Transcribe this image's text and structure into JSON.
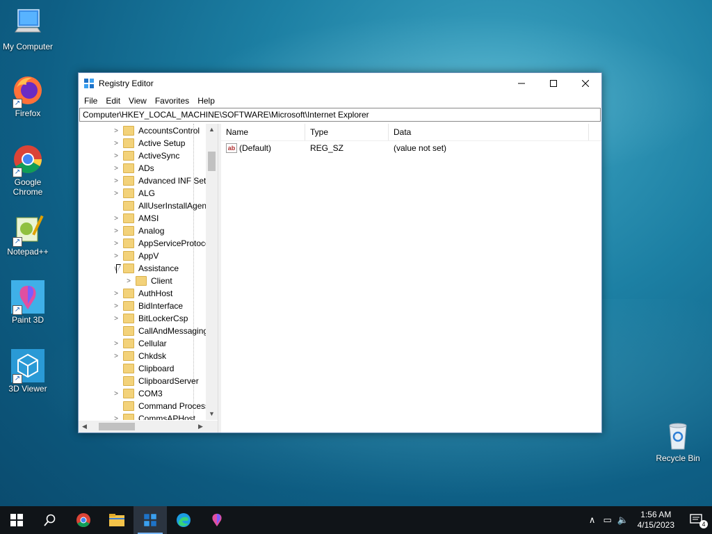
{
  "desktop": {
    "icons": [
      {
        "label": "My Computer"
      },
      {
        "label": "Firefox"
      },
      {
        "label": "Google Chrome"
      },
      {
        "label": "Notepad++"
      },
      {
        "label": "Paint 3D"
      },
      {
        "label": "3D Viewer"
      },
      {
        "label": "Recycle Bin"
      }
    ]
  },
  "window": {
    "title": "Registry Editor",
    "menu": [
      "File",
      "Edit",
      "View",
      "Favorites",
      "Help"
    ],
    "address": "Computer\\HKEY_LOCAL_MACHINE\\SOFTWARE\\Microsoft\\Internet Explorer",
    "tree": [
      {
        "label": "AccountsControl",
        "expander": ">"
      },
      {
        "label": "Active Setup",
        "expander": ">"
      },
      {
        "label": "ActiveSync",
        "expander": ">"
      },
      {
        "label": "ADs",
        "expander": ">"
      },
      {
        "label": "Advanced INF Setu",
        "expander": ">"
      },
      {
        "label": "ALG",
        "expander": ">"
      },
      {
        "label": "AllUserInstallAgent",
        "expander": ""
      },
      {
        "label": "AMSI",
        "expander": ">"
      },
      {
        "label": "Analog",
        "expander": ">"
      },
      {
        "label": "AppServiceProtoco",
        "expander": ">"
      },
      {
        "label": "AppV",
        "expander": ">"
      },
      {
        "label": "Assistance",
        "expander": "v"
      },
      {
        "label": "Client",
        "expander": ">",
        "child": true
      },
      {
        "label": "AuthHost",
        "expander": ">"
      },
      {
        "label": "BidInterface",
        "expander": ">"
      },
      {
        "label": "BitLockerCsp",
        "expander": ">"
      },
      {
        "label": "CallAndMessagingl",
        "expander": ""
      },
      {
        "label": "Cellular",
        "expander": ">"
      },
      {
        "label": "Chkdsk",
        "expander": ">"
      },
      {
        "label": "Clipboard",
        "expander": ""
      },
      {
        "label": "ClipboardServer",
        "expander": ""
      },
      {
        "label": "COM3",
        "expander": ">"
      },
      {
        "label": "Command Process",
        "expander": ""
      },
      {
        "label": "CommsAPHost",
        "expander": ">"
      }
    ],
    "columns": {
      "name": "Name",
      "type": "Type",
      "data": "Data"
    },
    "values": [
      {
        "name": "(Default)",
        "type": "REG_SZ",
        "data": "(value not set)"
      }
    ]
  },
  "taskbar": {
    "time": "1:56 AM",
    "date": "4/15/2023",
    "notifications": "4"
  }
}
